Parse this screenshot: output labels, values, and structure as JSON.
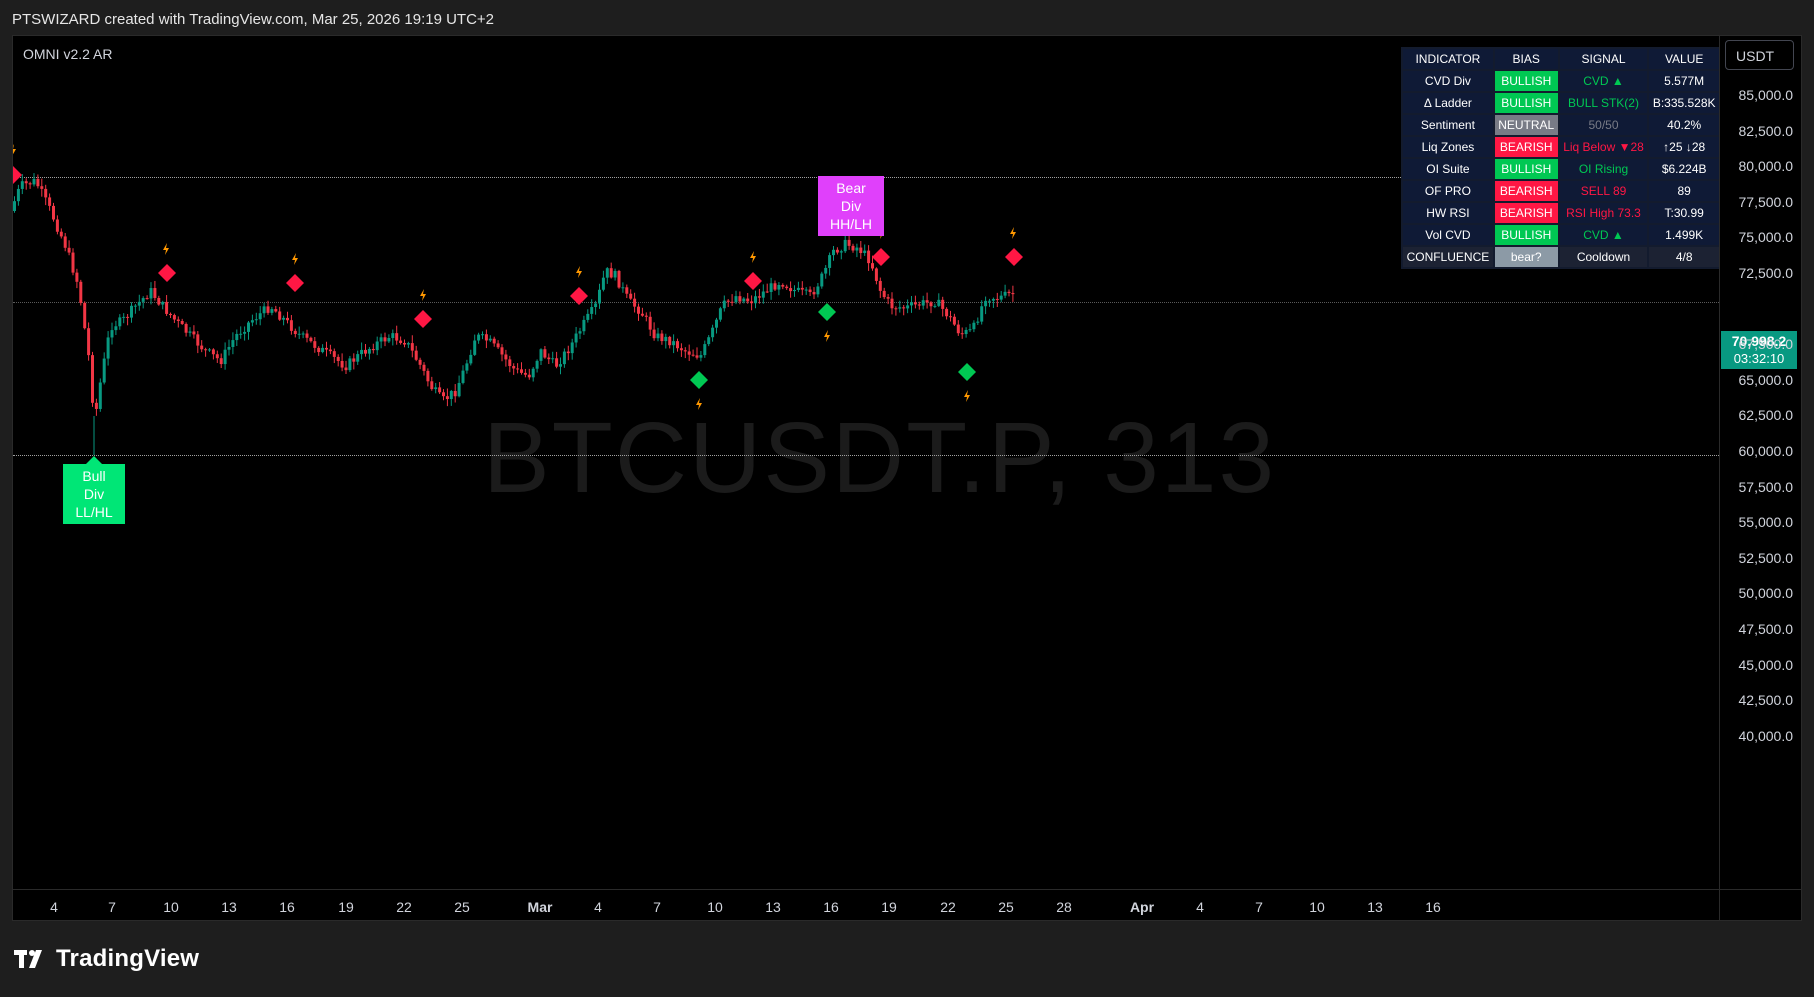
{
  "header": {
    "caption": "PTSWIZARD created with TradingView.com, Mar 25, 2026 19:19 UTC+2"
  },
  "chart": {
    "indicator_label": "OMNI v2.2 AR",
    "watermark": "BTCUSDT.P, 313",
    "currency_button": "USDT",
    "last_price": "70,998.2",
    "countdown": "03:32:10",
    "bull_div_label": [
      "Bull Div",
      "LL/HL"
    ],
    "bear_div_label": [
      "Bear Div",
      "HH/LH"
    ],
    "y_ticks": [
      "85,000.0",
      "82,500.0",
      "80,000.0",
      "77,500.0",
      "75,000.0",
      "72,500.0",
      "67,500.0",
      "65,000.0",
      "62,500.0",
      "60,000.0",
      "57,500.0",
      "55,000.0",
      "52,500.0",
      "50,000.0",
      "47,500.0",
      "45,000.0",
      "42,500.0",
      "40,000.0"
    ],
    "x_ticks": [
      {
        "label": "4",
        "month": false
      },
      {
        "label": "7",
        "month": false
      },
      {
        "label": "10",
        "month": false
      },
      {
        "label": "13",
        "month": false
      },
      {
        "label": "16",
        "month": false
      },
      {
        "label": "19",
        "month": false
      },
      {
        "label": "22",
        "month": false
      },
      {
        "label": "25",
        "month": false
      },
      {
        "label": "Mar",
        "month": true
      },
      {
        "label": "4",
        "month": false
      },
      {
        "label": "7",
        "month": false
      },
      {
        "label": "10",
        "month": false
      },
      {
        "label": "13",
        "month": false
      },
      {
        "label": "16",
        "month": false
      },
      {
        "label": "19",
        "month": false
      },
      {
        "label": "22",
        "month": false
      },
      {
        "label": "25",
        "month": false
      },
      {
        "label": "28",
        "month": false
      },
      {
        "label": "Apr",
        "month": true
      },
      {
        "label": "4",
        "month": false
      },
      {
        "label": "7",
        "month": false
      },
      {
        "label": "10",
        "month": false
      },
      {
        "label": "13",
        "month": false
      },
      {
        "label": "16",
        "month": false
      }
    ],
    "colors": {
      "bull": "#089981",
      "bear": "#f23645",
      "sell_marker": "#ff1744",
      "buy_marker": "#00c853",
      "bolt": "#ff9800"
    }
  },
  "panel": {
    "headers": [
      "INDICATOR",
      "BIAS",
      "SIGNAL",
      "VALUE"
    ],
    "rows": [
      {
        "name": "CVD Div",
        "bias": "BULLISH",
        "kind": "bull",
        "signal": "CVD ▲",
        "sigcolor": "#00c853",
        "value": "5.577M"
      },
      {
        "name": "Δ Ladder",
        "bias": "BULLISH",
        "kind": "bull",
        "signal": "BULL STK(2)",
        "sigcolor": "#00c853",
        "value": "B:335.528K"
      },
      {
        "name": "Sentiment",
        "bias": "NEUTRAL",
        "kind": "neut",
        "signal": "50/50",
        "sigcolor": "#787b86",
        "value": "40.2%"
      },
      {
        "name": "Liq Zones",
        "bias": "BEARISH",
        "kind": "bear",
        "signal": "Liq Below ▼28",
        "sigcolor": "#ff1744",
        "value": "↑25 ↓28"
      },
      {
        "name": "OI Suite",
        "bias": "BULLISH",
        "kind": "bull",
        "signal": "OI Rising",
        "sigcolor": "#00c853",
        "value": "$6.224B"
      },
      {
        "name": "OF PRO",
        "bias": "BEARISH",
        "kind": "bear",
        "signal": "SELL 89",
        "sigcolor": "#ff1744",
        "value": "89"
      },
      {
        "name": "HW RSI",
        "bias": "BEARISH",
        "kind": "bear",
        "signal": "RSI High 73.3",
        "sigcolor": "#ff1744",
        "value": "T:30.99"
      },
      {
        "name": "Vol CVD",
        "bias": "BULLISH",
        "kind": "bull",
        "signal": "CVD ▲",
        "sigcolor": "#00c853",
        "value": "1.499K"
      }
    ],
    "confluence": {
      "name": "CONFLUENCE",
      "bias": "bear?",
      "signal": "Cooldown",
      "value": "4/8"
    }
  },
  "footer": {
    "brand": "TradingView"
  }
}
